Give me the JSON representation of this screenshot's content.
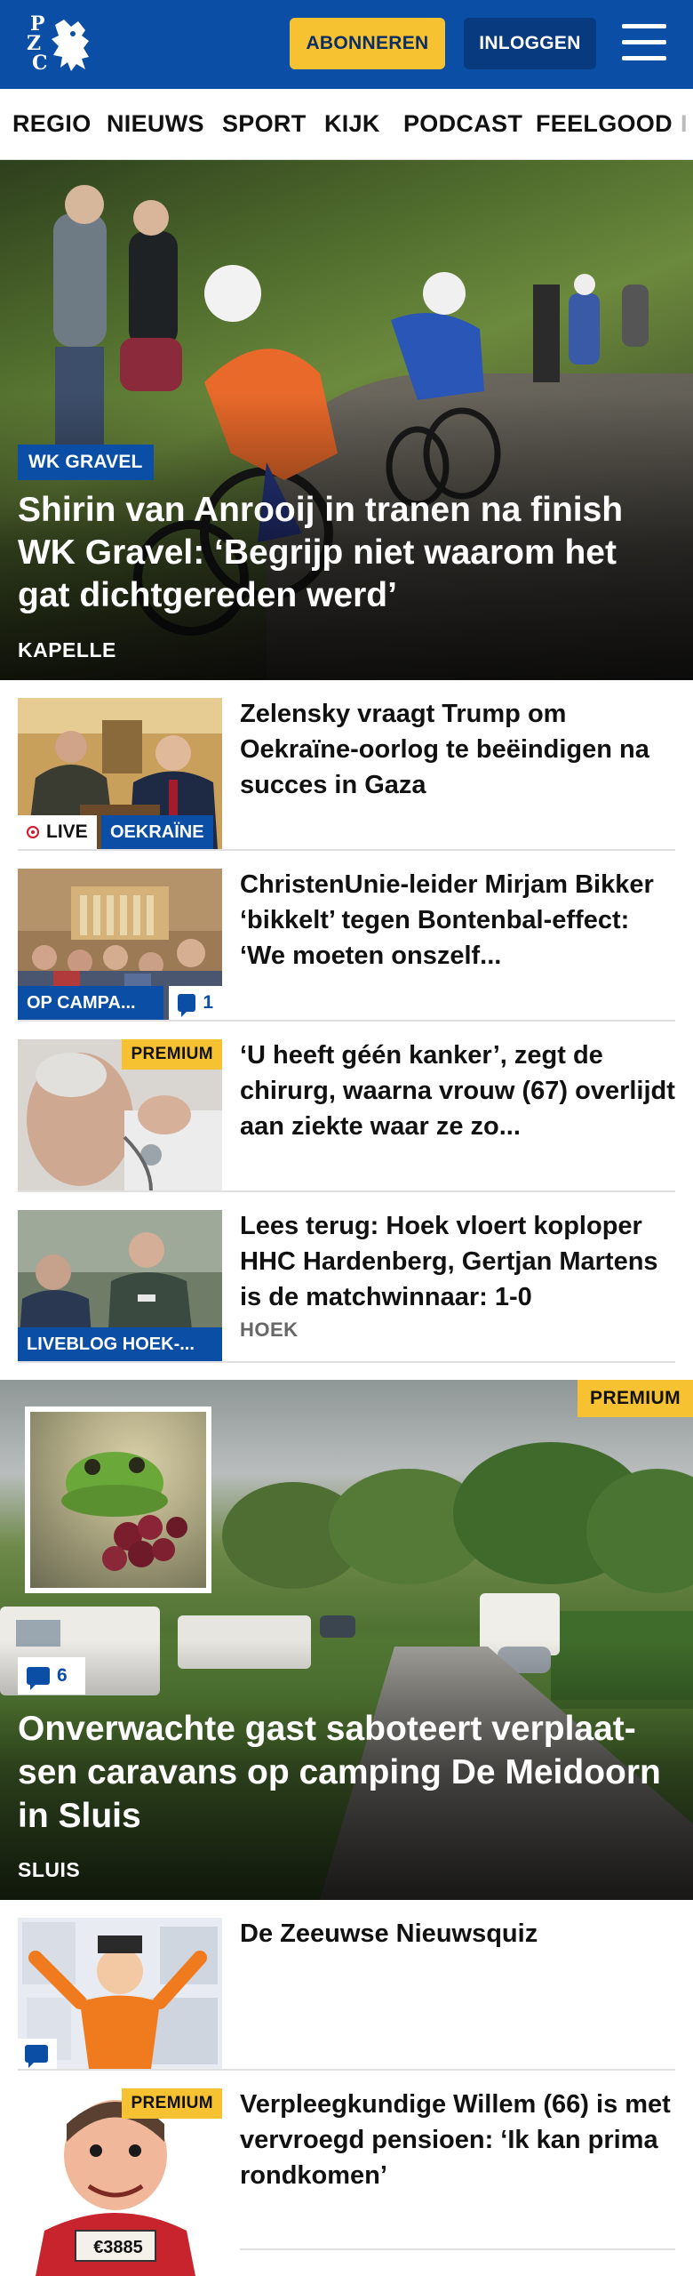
{
  "header": {
    "logo_lines": [
      "P",
      "Z",
      "C"
    ],
    "subscribe_label": "ABONNEREN",
    "login_label": "INLOGGEN",
    "menu_icon": "hamburger-icon",
    "brand_color": "#0a4fa5",
    "accent_color": "#f6c232"
  },
  "nav": {
    "items": [
      "REGIO",
      "NIEUWS",
      "SPORT",
      "KIJK",
      "PODCAST",
      "FEELGOOD",
      "I"
    ]
  },
  "hero": {
    "tag": "WK GRAVEL",
    "title": "Shirin van Anrooij in tranen na finish WK Gravel: ‘Begrijp niet waarom het gat dichtgereden werd’",
    "location": "KAPELLE"
  },
  "articles": [
    {
      "title": "Zelensky vraagt Trump om Oekraïne-oorlog te beëindigen na succes in Gaza",
      "live_label": "LIVE",
      "tag": "OEKRAÏNE"
    },
    {
      "title": "ChristenUnie-leider Mirjam Bikker ‘bikkelt’ tegen Bontenbal-effect: ‘We moeten onszelf...",
      "tag": "OP CAMPA...",
      "comments": "1"
    },
    {
      "title": "‘U heeft géén kanker’, zegt de chirurg, waarna vrouw (67) overlijdt aan ziekte waar ze zo...",
      "premium": "PREMIUM"
    },
    {
      "title": "Lees terug: Hoek vloert koploper HHC Hardenberg, Gertjan Martens is de matchwinnaar: 1-0",
      "location": "HOEK",
      "tag": "LIVEBLOG HOEK-..."
    }
  ],
  "feature": {
    "premium": "PREMIUM",
    "comments": "6",
    "title": "Onverwachte gast saboteert verplaat-sen caravans op camping De Meidoorn in Sluis",
    "location": "SLUIS"
  },
  "articles_bottom": [
    {
      "title": "De Zeeuwse Nieuwsquiz"
    },
    {
      "title": "Verpleegkundige Willem (66) is met vervroegd pensioen: ‘Ik kan prima rondkomen’",
      "premium": "PREMIUM",
      "sign_text": "€3885"
    }
  ]
}
